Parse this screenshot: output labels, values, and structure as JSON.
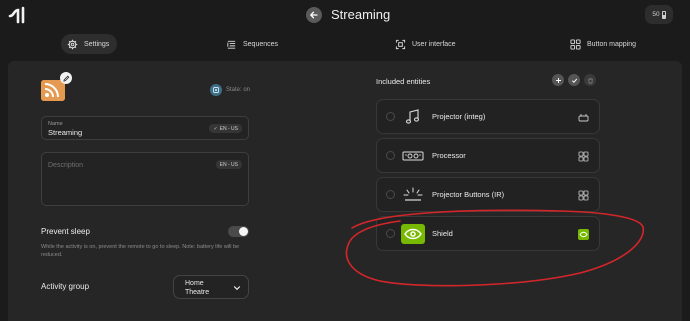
{
  "header": {
    "title": "Streaming",
    "battery": "50"
  },
  "tabs": [
    {
      "label": "Settings",
      "icon": "gear-icon",
      "active": true
    },
    {
      "label": "Sequences",
      "icon": "sequences-icon",
      "active": false
    },
    {
      "label": "User interface",
      "icon": "user-interface-icon",
      "active": false
    },
    {
      "label": "Button mapping",
      "icon": "button-mapping-icon",
      "active": false
    }
  ],
  "activity": {
    "icon": "rss-icon",
    "state": "State: on",
    "name_label": "Name",
    "name_value": "Streaming",
    "name_lang": "EN - US",
    "description_placeholder": "Description",
    "description_lang": "EN - US",
    "prevent_sleep_label": "Prevent sleep",
    "prevent_sleep_on": true,
    "prevent_sleep_help": "While the activity is on, prevent the remote to go to sleep. Note: battery life will be reduced.",
    "group_label": "Activity group",
    "group_value": "Home Theatre"
  },
  "entities": {
    "title": "Included entities",
    "items": [
      {
        "name": "Projector (integ)",
        "icon": "music-note-icon",
        "tail_icon": "integration-icon"
      },
      {
        "name": "Processor",
        "icon": "processor-device-icon",
        "tail_icon": "ir-remote-icon"
      },
      {
        "name": "Projector Buttons (IR)",
        "icon": "ir-beam-icon",
        "tail_icon": "ir-remote-icon"
      },
      {
        "name": "Shield",
        "icon": "nvidia-shield-icon",
        "tail_icon": "nvidia-small-icon"
      }
    ]
  },
  "colors": {
    "background": "#1b1b1b",
    "panel": "#262626",
    "accent_orange": "#e59a52",
    "annotation_red": "#d3262b",
    "nvidia_green": "#76b900"
  }
}
